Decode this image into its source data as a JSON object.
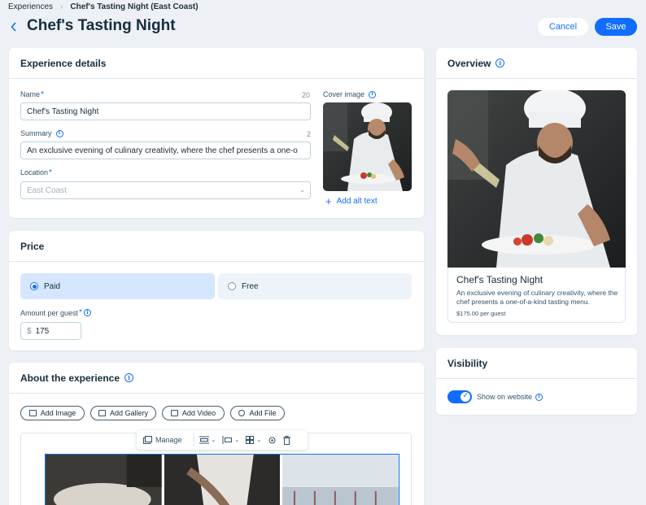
{
  "breadcrumb": {
    "root": "Experiences",
    "current": "Chef's Tasting Night (East Coast)"
  },
  "header": {
    "title": "Chef's Tasting Night",
    "cancel_label": "Cancel",
    "save_label": "Save"
  },
  "details": {
    "title": "Experience details",
    "name_label": "Name",
    "name_counter": "20",
    "name_value": "Chef's Tasting Night",
    "summary_label": "Summary",
    "summary_counter": "2",
    "summary_value": "An exclusive evening of culinary creativity, where the chef presents a one-o",
    "location_label": "Location",
    "location_placeholder": "East Coast",
    "cover_label": "Cover image",
    "add_alt_label": "Add alt text"
  },
  "price": {
    "title": "Price",
    "options": [
      "Paid",
      "Free"
    ],
    "selected": "Paid",
    "amount_label": "Amount per guest",
    "currency": "$",
    "amount_value": "175"
  },
  "about": {
    "title": "About the experience",
    "buttons": [
      "Add Image",
      "Add Gallery",
      "Add Video",
      "Add File"
    ],
    "toolbar_manage": "Manage"
  },
  "overview": {
    "title": "Overview",
    "card_title": "Chef's Tasting Night",
    "card_summary": "An exclusive evening of culinary creativity, where the chef presents a one-of-a-kind tasting menu.",
    "card_price": "$175.00 per guest"
  },
  "visibility": {
    "title": "Visibility",
    "toggle_label": "Show on website",
    "toggle_on": true
  },
  "colors": {
    "accent": "#116dff",
    "background": "#edf1f6",
    "selected_option": "#d5e6fe"
  }
}
